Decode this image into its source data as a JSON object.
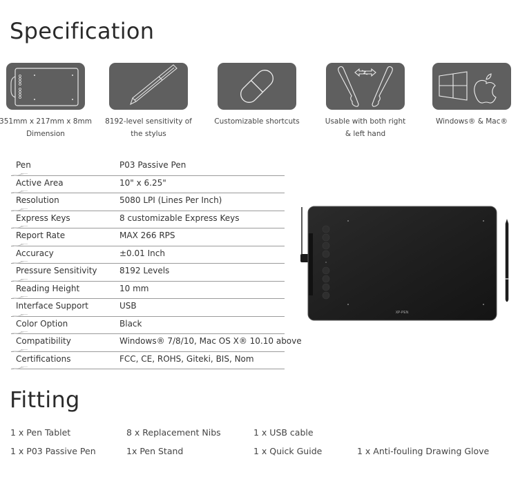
{
  "spec_title": "Specification",
  "features": [
    {
      "icon": "tablet-outline-icon",
      "caption_line1": "351mm x 217mm x 8mm",
      "caption_line2": "Dimension"
    },
    {
      "icon": "stylus-pen-icon",
      "caption_line1": "8192-level sensitivity of",
      "caption_line2": "the stylus"
    },
    {
      "icon": "capsule-shortcut-icon",
      "caption_line1": "Customizable shortcuts",
      "caption_line2": ""
    },
    {
      "icon": "left-right-hand-icon",
      "caption_line1": "Usable with both right",
      "caption_line2": "& left hand"
    },
    {
      "icon": "windows-mac-icon",
      "caption_line1": "Windows® & Mac®",
      "caption_line2": ""
    }
  ],
  "specs": [
    {
      "key": "Pen",
      "value": "P03 Passive Pen"
    },
    {
      "key": "Active Area",
      "value": "10\" x 6.25\""
    },
    {
      "key": "Resolution",
      "value": "5080 LPI (Lines Per Inch)"
    },
    {
      "key": "Express Keys",
      "value": "8 customizable Express Keys"
    },
    {
      "key": "Report Rate",
      "value": "MAX 266 RPS"
    },
    {
      "key": "Accuracy",
      "value": "±0.01 Inch"
    },
    {
      "key": "Pressure Sensitivity",
      "value": "8192 Levels"
    },
    {
      "key": "Reading Height",
      "value": "10 mm"
    },
    {
      "key": "Interface Support",
      "value": "USB"
    },
    {
      "key": "Color Option",
      "value": "Black"
    },
    {
      "key": "Compatibility",
      "value": "Windows® 7/8/10, Mac OS X® 10.10 above"
    },
    {
      "key": "Certifications",
      "value": "FCC, CE, ROHS, Giteki, BIS, Nom"
    }
  ],
  "product_image": {
    "brand_label": "XP-PEN"
  },
  "fit_title": "Fitting",
  "fitting": [
    "1 x Pen Tablet",
    "8 x Replacement Nibs",
    "1 x USB cable",
    "1 x P03 Passive Pen",
    "1x Pen Stand",
    "1 x Quick Guide",
    "1 x Anti-fouling Drawing Glove"
  ]
}
